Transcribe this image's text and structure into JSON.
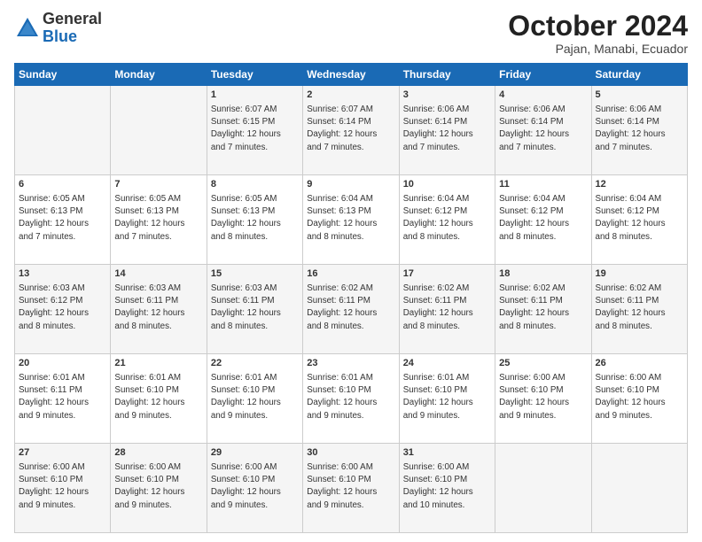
{
  "logo": {
    "general": "General",
    "blue": "Blue"
  },
  "header": {
    "month": "October 2024",
    "location": "Pajan, Manabi, Ecuador"
  },
  "days_of_week": [
    "Sunday",
    "Monday",
    "Tuesday",
    "Wednesday",
    "Thursday",
    "Friday",
    "Saturday"
  ],
  "weeks": [
    [
      {
        "day": "",
        "info": ""
      },
      {
        "day": "",
        "info": ""
      },
      {
        "day": "1",
        "info": "Sunrise: 6:07 AM\nSunset: 6:15 PM\nDaylight: 12 hours\nand 7 minutes."
      },
      {
        "day": "2",
        "info": "Sunrise: 6:07 AM\nSunset: 6:14 PM\nDaylight: 12 hours\nand 7 minutes."
      },
      {
        "day": "3",
        "info": "Sunrise: 6:06 AM\nSunset: 6:14 PM\nDaylight: 12 hours\nand 7 minutes."
      },
      {
        "day": "4",
        "info": "Sunrise: 6:06 AM\nSunset: 6:14 PM\nDaylight: 12 hours\nand 7 minutes."
      },
      {
        "day": "5",
        "info": "Sunrise: 6:06 AM\nSunset: 6:14 PM\nDaylight: 12 hours\nand 7 minutes."
      }
    ],
    [
      {
        "day": "6",
        "info": "Sunrise: 6:05 AM\nSunset: 6:13 PM\nDaylight: 12 hours\nand 7 minutes."
      },
      {
        "day": "7",
        "info": "Sunrise: 6:05 AM\nSunset: 6:13 PM\nDaylight: 12 hours\nand 7 minutes."
      },
      {
        "day": "8",
        "info": "Sunrise: 6:05 AM\nSunset: 6:13 PM\nDaylight: 12 hours\nand 8 minutes."
      },
      {
        "day": "9",
        "info": "Sunrise: 6:04 AM\nSunset: 6:13 PM\nDaylight: 12 hours\nand 8 minutes."
      },
      {
        "day": "10",
        "info": "Sunrise: 6:04 AM\nSunset: 6:12 PM\nDaylight: 12 hours\nand 8 minutes."
      },
      {
        "day": "11",
        "info": "Sunrise: 6:04 AM\nSunset: 6:12 PM\nDaylight: 12 hours\nand 8 minutes."
      },
      {
        "day": "12",
        "info": "Sunrise: 6:04 AM\nSunset: 6:12 PM\nDaylight: 12 hours\nand 8 minutes."
      }
    ],
    [
      {
        "day": "13",
        "info": "Sunrise: 6:03 AM\nSunset: 6:12 PM\nDaylight: 12 hours\nand 8 minutes."
      },
      {
        "day": "14",
        "info": "Sunrise: 6:03 AM\nSunset: 6:11 PM\nDaylight: 12 hours\nand 8 minutes."
      },
      {
        "day": "15",
        "info": "Sunrise: 6:03 AM\nSunset: 6:11 PM\nDaylight: 12 hours\nand 8 minutes."
      },
      {
        "day": "16",
        "info": "Sunrise: 6:02 AM\nSunset: 6:11 PM\nDaylight: 12 hours\nand 8 minutes."
      },
      {
        "day": "17",
        "info": "Sunrise: 6:02 AM\nSunset: 6:11 PM\nDaylight: 12 hours\nand 8 minutes."
      },
      {
        "day": "18",
        "info": "Sunrise: 6:02 AM\nSunset: 6:11 PM\nDaylight: 12 hours\nand 8 minutes."
      },
      {
        "day": "19",
        "info": "Sunrise: 6:02 AM\nSunset: 6:11 PM\nDaylight: 12 hours\nand 8 minutes."
      }
    ],
    [
      {
        "day": "20",
        "info": "Sunrise: 6:01 AM\nSunset: 6:11 PM\nDaylight: 12 hours\nand 9 minutes."
      },
      {
        "day": "21",
        "info": "Sunrise: 6:01 AM\nSunset: 6:10 PM\nDaylight: 12 hours\nand 9 minutes."
      },
      {
        "day": "22",
        "info": "Sunrise: 6:01 AM\nSunset: 6:10 PM\nDaylight: 12 hours\nand 9 minutes."
      },
      {
        "day": "23",
        "info": "Sunrise: 6:01 AM\nSunset: 6:10 PM\nDaylight: 12 hours\nand 9 minutes."
      },
      {
        "day": "24",
        "info": "Sunrise: 6:01 AM\nSunset: 6:10 PM\nDaylight: 12 hours\nand 9 minutes."
      },
      {
        "day": "25",
        "info": "Sunrise: 6:00 AM\nSunset: 6:10 PM\nDaylight: 12 hours\nand 9 minutes."
      },
      {
        "day": "26",
        "info": "Sunrise: 6:00 AM\nSunset: 6:10 PM\nDaylight: 12 hours\nand 9 minutes."
      }
    ],
    [
      {
        "day": "27",
        "info": "Sunrise: 6:00 AM\nSunset: 6:10 PM\nDaylight: 12 hours\nand 9 minutes."
      },
      {
        "day": "28",
        "info": "Sunrise: 6:00 AM\nSunset: 6:10 PM\nDaylight: 12 hours\nand 9 minutes."
      },
      {
        "day": "29",
        "info": "Sunrise: 6:00 AM\nSunset: 6:10 PM\nDaylight: 12 hours\nand 9 minutes."
      },
      {
        "day": "30",
        "info": "Sunrise: 6:00 AM\nSunset: 6:10 PM\nDaylight: 12 hours\nand 9 minutes."
      },
      {
        "day": "31",
        "info": "Sunrise: 6:00 AM\nSunset: 6:10 PM\nDaylight: 12 hours\nand 10 minutes."
      },
      {
        "day": "",
        "info": ""
      },
      {
        "day": "",
        "info": ""
      }
    ]
  ]
}
